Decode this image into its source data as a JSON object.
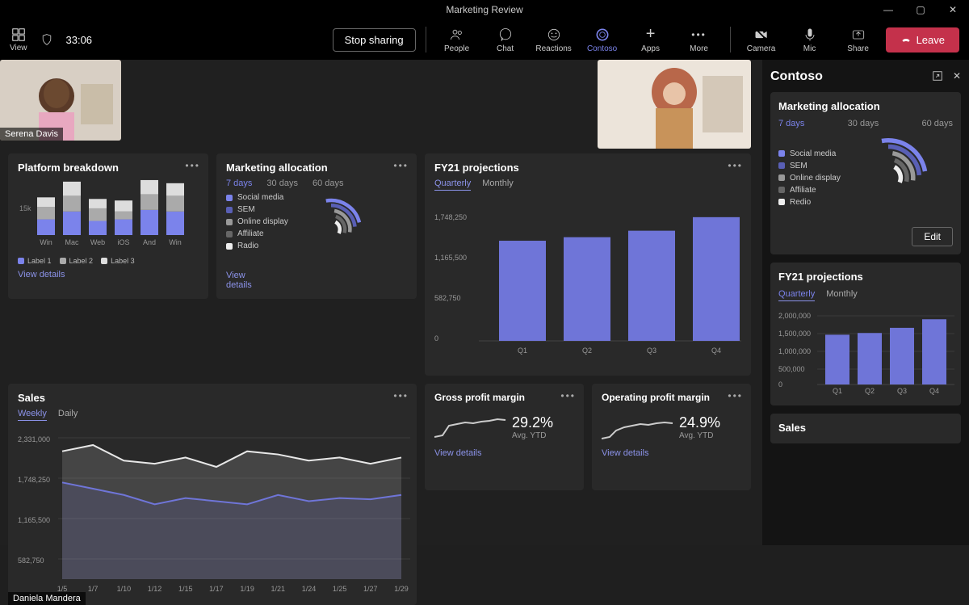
{
  "window": {
    "title": "Marketing Review"
  },
  "topbar": {
    "view_label": "View",
    "timer": "33:06",
    "stop_sharing": "Stop sharing",
    "icons": {
      "people": "People",
      "chat": "Chat",
      "reactions": "Reactions",
      "contoso": "Contoso",
      "apps": "Apps",
      "more": "More",
      "camera": "Camera",
      "mic": "Mic",
      "share": "Share"
    },
    "leave": "Leave"
  },
  "participants": {
    "p1": "Serena Davis",
    "p2": "Daniela Mandera"
  },
  "sidepanel": {
    "title": "Contoso",
    "marketing_title": "Marketing allocation",
    "tabs": {
      "d7": "7 days",
      "d30": "30 days",
      "d60": "60 days"
    },
    "legend": [
      "Social media",
      "SEM",
      "Online display",
      "Affiliate",
      "Redio"
    ],
    "edit": "Edit",
    "fy21_title": "FY21 projections",
    "fy21_tabs": {
      "q": "Quarterly",
      "m": "Monthly"
    },
    "sales_title": "Sales"
  },
  "cards": {
    "platform": {
      "title": "Platform breakdown",
      "ylabel": "15k",
      "categories": [
        "Win",
        "Mac",
        "Web",
        "iOS",
        "And",
        "Win"
      ],
      "legend": [
        "Label 1",
        "Label 2",
        "Label 3"
      ],
      "view": "View details"
    },
    "marketing": {
      "title": "Marketing allocation",
      "tabs": {
        "d7": "7 days",
        "d30": "30 days",
        "d60": "60 days"
      },
      "legend": [
        "Social media",
        "SEM",
        "Online display",
        "Affiliate",
        "Radio"
      ],
      "view": "View details"
    },
    "fy21": {
      "title": "FY21 projections",
      "tabs": {
        "q": "Quarterly",
        "m": "Monthly"
      },
      "yticks": [
        "1,748,250",
        "1,165,500",
        "582,750",
        "0"
      ],
      "categories": [
        "Q1",
        "Q2",
        "Q3",
        "Q4"
      ]
    },
    "sales": {
      "title": "Sales",
      "tabs": {
        "w": "Weekly",
        "d": "Daily"
      },
      "yticks": [
        "2,331,000",
        "1,748,250",
        "1,165,500",
        "582,750"
      ],
      "xticks": [
        "1/5",
        "1/7",
        "1/10",
        "1/12",
        "1/15",
        "1/17",
        "1/19",
        "1/21",
        "1/24",
        "1/25",
        "1/27",
        "1/29"
      ]
    },
    "gross": {
      "title": "Gross profit margin",
      "value": "29.2%",
      "sub": "Avg. YTD",
      "view": "View details"
    },
    "operating": {
      "title": "Operating profit margin",
      "value": "24.9%",
      "sub": "Avg. YTD",
      "view": "View details"
    }
  },
  "chart_data": [
    {
      "type": "bar",
      "title": "Platform breakdown",
      "categories": [
        "Win",
        "Mac",
        "Web",
        "iOS",
        "And",
        "Win"
      ],
      "series": [
        {
          "name": "Label 1",
          "values": [
            5000,
            7500,
            4500,
            5000,
            8000,
            7500
          ]
        },
        {
          "name": "Label 2",
          "values": [
            4000,
            5000,
            4000,
            2500,
            5000,
            5000
          ]
        },
        {
          "name": "Label 3",
          "values": [
            3000,
            4500,
            3000,
            3500,
            4500,
            4000
          ]
        }
      ],
      "ylim": [
        0,
        18000
      ],
      "ylabel": "15k"
    },
    {
      "type": "pie",
      "title": "Marketing allocation",
      "series": [
        {
          "name": "Social media",
          "value": 30
        },
        {
          "name": "SEM",
          "value": 25
        },
        {
          "name": "Online display",
          "value": 20
        },
        {
          "name": "Affiliate",
          "value": 15
        },
        {
          "name": "Radio",
          "value": 10
        }
      ]
    },
    {
      "type": "bar",
      "title": "FY21 projections",
      "categories": [
        "Q1",
        "Q2",
        "Q3",
        "Q4"
      ],
      "values": [
        1700000,
        1760000,
        1870000,
        2100000
      ],
      "ylim": [
        0,
        2331000
      ]
    },
    {
      "type": "line",
      "title": "Sales",
      "x": [
        "1/5",
        "1/7",
        "1/10",
        "1/12",
        "1/15",
        "1/17",
        "1/19",
        "1/21",
        "1/24",
        "1/25",
        "1/27",
        "1/29"
      ],
      "series": [
        {
          "name": "series1",
          "values": [
            2050000,
            2150000,
            1900000,
            1850000,
            1950000,
            1800000,
            2050000,
            2000000,
            1900000,
            1950000,
            1850000,
            1950000
          ]
        },
        {
          "name": "series2",
          "values": [
            1550000,
            1450000,
            1350000,
            1200000,
            1300000,
            1250000,
            1200000,
            1350000,
            1250000,
            1300000,
            1280000,
            1350000
          ]
        }
      ],
      "ylim": [
        0,
        2331000
      ]
    },
    {
      "type": "bar",
      "title": "FY21 projections (side)",
      "categories": [
        "Q1",
        "Q2",
        "Q3",
        "Q4"
      ],
      "values": [
        1450000,
        1500000,
        1650000,
        1900000
      ],
      "ylim": [
        0,
        2000000
      ],
      "yticks": [
        "2,000,000",
        "1,500,000",
        "1,000,000",
        "500,000",
        "0"
      ]
    },
    {
      "type": "line",
      "title": "Gross profit margin",
      "x": [
        1,
        2,
        3,
        4,
        5,
        6,
        7,
        8,
        9,
        10
      ],
      "values": [
        10,
        12,
        22,
        24,
        26,
        25,
        27,
        28,
        30,
        29
      ],
      "summary": "29.2%",
      "sub": "Avg. YTD"
    },
    {
      "type": "line",
      "title": "Operating profit margin",
      "x": [
        1,
        2,
        3,
        4,
        5,
        6,
        7,
        8,
        9,
        10
      ],
      "values": [
        8,
        10,
        16,
        20,
        22,
        24,
        23,
        25,
        26,
        25
      ],
      "summary": "24.9%",
      "sub": "Avg. YTD"
    }
  ],
  "colors": {
    "purple": "#7b83eb",
    "purple2": "#595fb5",
    "grey": "#999",
    "grey2": "#ccc",
    "dark": "#555",
    "white": "#eee"
  }
}
